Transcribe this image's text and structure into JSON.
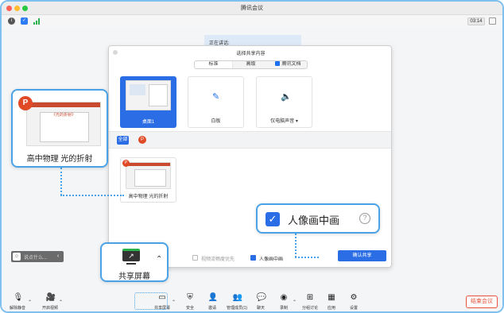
{
  "window": {
    "title": "腾讯会议"
  },
  "infobar": {
    "info_icon": "info-icon",
    "shield_icon": "shield-icon",
    "signal_icon": "signal-icon",
    "timer": "03:14"
  },
  "speaking": {
    "label": "正在讲话:"
  },
  "modal": {
    "title": "选择共享内容",
    "tabs": [
      {
        "label": "标准",
        "active": true
      },
      {
        "label": "高级",
        "active": false
      },
      {
        "label": "腾讯文档",
        "active": false
      }
    ],
    "options": [
      {
        "label": "桌面1",
        "selected": true
      },
      {
        "label": "白板",
        "selected": false
      },
      {
        "label": "仅电脑声音",
        "selected": false
      }
    ],
    "filters": {
      "all": "全部",
      "ppt": "P"
    },
    "windows": [
      {
        "label": "高中物理 光的折射"
      }
    ],
    "footer": {
      "fluency_label": "视频流畅度优先",
      "portrait_label": "人像画中画",
      "confirm": "确认共享"
    }
  },
  "callouts": {
    "ppt": {
      "logo": "P",
      "heading": "《光的折射》",
      "label": "高中物理 光的折射"
    },
    "portrait": {
      "check": "✓",
      "label": "人像画中画",
      "help": "?"
    },
    "share": {
      "label": "共享屏幕"
    }
  },
  "chat": {
    "placeholder": "说点什么..."
  },
  "toolbar": {
    "items": [
      {
        "label": "解除静音",
        "icon": "mic-icon"
      },
      {
        "label": "开启视频",
        "icon": "video-icon"
      },
      {
        "label": "共享屏幕",
        "icon": "share-screen-icon"
      },
      {
        "label": "安全",
        "icon": "shield-icon"
      },
      {
        "label": "邀请",
        "icon": "invite-icon"
      },
      {
        "label": "管理成员(1)",
        "icon": "members-icon"
      },
      {
        "label": "聊天",
        "icon": "chat-icon"
      },
      {
        "label": "录制",
        "icon": "record-icon"
      },
      {
        "label": "分组讨论",
        "icon": "breakout-icon"
      },
      {
        "label": "应用",
        "icon": "apps-icon"
      },
      {
        "label": "设置",
        "icon": "settings-icon"
      }
    ],
    "leave": "结束会议"
  },
  "colors": {
    "accent": "#2b6de5",
    "callout_border": "#4aa3e8",
    "leave": "#e8503a",
    "ppt": "#e04a26"
  }
}
